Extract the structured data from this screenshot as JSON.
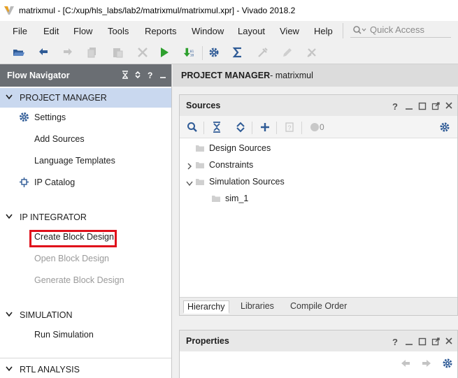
{
  "window": {
    "title": "matrixmul - [C:/xup/hls_labs/lab2/matrixmul/matrixmul.xpr] - Vivado 2018.2"
  },
  "menu": {
    "items": [
      "File",
      "Edit",
      "Flow",
      "Tools",
      "Reports",
      "Window",
      "Layout",
      "View",
      "Help"
    ],
    "quick_access_placeholder": "Quick Access"
  },
  "toolbar": {
    "icons": [
      "open-project-icon",
      "undo-icon",
      "redo-icon",
      "copy-icon",
      "paste-icon",
      "delete-icon",
      "run-icon",
      "program-device-icon",
      "settings-icon",
      "sigma-icon",
      "disabled-tool-icon",
      "disabled-edit-icon",
      "disabled-clear-icon"
    ]
  },
  "flow_navigator": {
    "title": "Flow Navigator",
    "sections": [
      {
        "label": "PROJECT MANAGER",
        "items": [
          "Settings",
          "Add Sources",
          "Language Templates",
          "IP Catalog"
        ]
      },
      {
        "label": "IP INTEGRATOR",
        "items": [
          "Create Block Design",
          "Open Block Design",
          "Generate Block Design"
        ]
      },
      {
        "label": "SIMULATION",
        "items": [
          "Run Simulation"
        ]
      },
      {
        "label": "RTL ANALYSIS",
        "items": []
      }
    ]
  },
  "main": {
    "header_bold": "PROJECT MANAGER",
    "header_rest": " - matrixmul",
    "sources": {
      "title": "Sources",
      "count": "0",
      "tree": [
        "Design Sources",
        "Constraints",
        "Simulation Sources",
        "sim_1"
      ],
      "tabs": [
        "Hierarchy",
        "Libraries",
        "Compile Order"
      ]
    },
    "properties": {
      "title": "Properties"
    }
  },
  "colors": {
    "nav_header": "#6a6e73",
    "active_section": "#c9d8ef",
    "highlight": "#e0101b",
    "run_green": "#2ea02e",
    "icon_blue": "#2f5b96"
  }
}
